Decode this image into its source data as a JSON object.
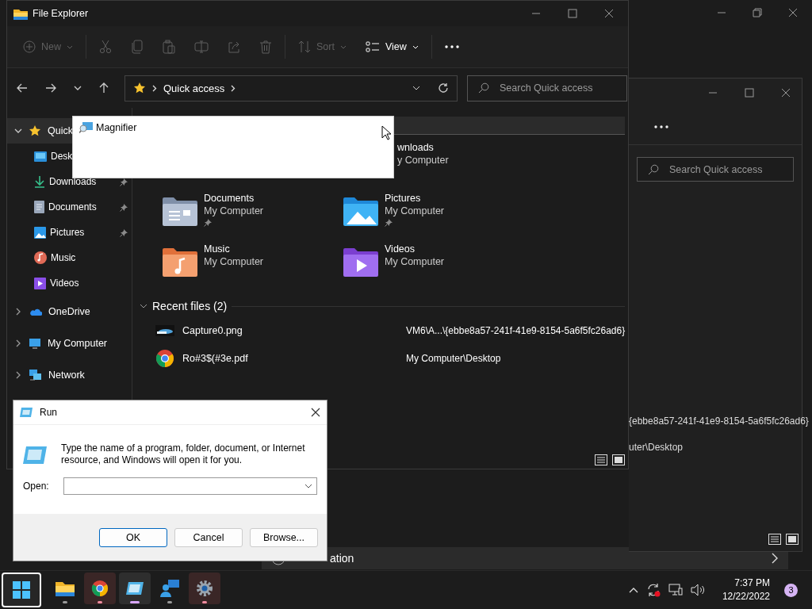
{
  "background_window": {
    "bottom_item": {
      "title": "ation"
    }
  },
  "second_window": {
    "search": {
      "placeholder": "Search Quick access"
    },
    "recent_paths": [
      "{ebbe8a57-241f-41e9-8154-5a6f5fc26ad6}",
      "uter\\Desktop"
    ]
  },
  "main_window": {
    "title": "File Explorer",
    "toolbar": [
      {
        "kind": "new",
        "label": "New",
        "disabled": true
      },
      {
        "kind": "cut",
        "disabled": true
      },
      {
        "kind": "copy",
        "disabled": true
      },
      {
        "kind": "paste",
        "disabled": true
      },
      {
        "kind": "rename",
        "disabled": true
      },
      {
        "kind": "share",
        "disabled": true
      },
      {
        "kind": "delete",
        "disabled": true
      },
      {
        "kind": "sort",
        "label": "Sort",
        "disabled": true
      },
      {
        "kind": "view",
        "label": "View",
        "disabled": false
      },
      {
        "kind": "more",
        "disabled": false
      }
    ],
    "address": {
      "location": "Quick access"
    },
    "search": {
      "placeholder": "Search Quick access"
    },
    "sidebar": [
      {
        "kind": "star",
        "label": "Quick",
        "expanded": true,
        "selected": true,
        "children": [
          {
            "kind": "desktop",
            "label": "Desk",
            "pinned": false
          },
          {
            "kind": "downloads",
            "label": "Downloads",
            "pinned": true
          },
          {
            "kind": "documents",
            "label": "Documents",
            "pinned": true
          },
          {
            "kind": "pictures",
            "label": "Pictures",
            "pinned": true
          },
          {
            "kind": "music",
            "label": "Music",
            "pinned": false
          },
          {
            "kind": "videos",
            "label": "Videos",
            "pinned": false
          }
        ]
      },
      {
        "kind": "onedrive",
        "label": "OneDrive",
        "expanded": false,
        "selected": false
      },
      {
        "kind": "computer",
        "label": "My Computer",
        "expanded": false,
        "selected": false
      },
      {
        "kind": "network",
        "label": "Network",
        "expanded": false,
        "selected": false
      }
    ],
    "folders": [
      {
        "kind": "hidden",
        "name": "wnloads",
        "location": "y Computer"
      },
      {
        "kind": "documents",
        "name": "Documents",
        "location": "My Computer",
        "pinned": true
      },
      {
        "kind": "pictures",
        "name": "Pictures",
        "location": "My Computer",
        "pinned": true
      },
      {
        "kind": "music",
        "name": "Music",
        "location": "My Computer",
        "pinned": false
      },
      {
        "kind": "videos",
        "name": "Videos",
        "location": "My Computer",
        "pinned": false
      }
    ],
    "recent": {
      "title": "Recent files (2)",
      "expanded": true,
      "files": [
        {
          "kind": "image",
          "name": "Capture0.png",
          "path": "VM6\\A...\\{ebbe8a57-241f-41e9-8154-5a6f5fc26ad6}"
        },
        {
          "kind": "browser",
          "name": "Ro#3$(#3e.pdf",
          "path": "My Computer\\Desktop"
        }
      ]
    }
  },
  "magnifier": {
    "title": "Magnifier"
  },
  "run_dialog": {
    "title": "Run",
    "description": "Type the name of a program, folder, document, or Internet resource, and Windows will open it for you.",
    "open_label": "Open:",
    "buttons": [
      {
        "label": "OK",
        "default": true
      },
      {
        "label": "Cancel",
        "default": false
      },
      {
        "label": "Browse...",
        "default": false
      }
    ]
  },
  "taskbar": {
    "apps": [
      {
        "kind": "start",
        "focused": true,
        "running": false,
        "active": false,
        "attention": false
      },
      {
        "kind": "explorer",
        "focused": false,
        "running": true,
        "active": false,
        "attention": false
      },
      {
        "kind": "browser",
        "focused": false,
        "running": true,
        "active": false,
        "attention": true
      },
      {
        "kind": "run",
        "focused": false,
        "running": true,
        "active": true,
        "attention": false
      },
      {
        "kind": "feedback",
        "focused": false,
        "running": true,
        "active": false,
        "attention": false
      },
      {
        "kind": "settings",
        "focused": false,
        "running": true,
        "active": false,
        "attention": true
      }
    ],
    "time": "7:37 PM",
    "date": "12/22/2022",
    "notification_count": "3"
  }
}
